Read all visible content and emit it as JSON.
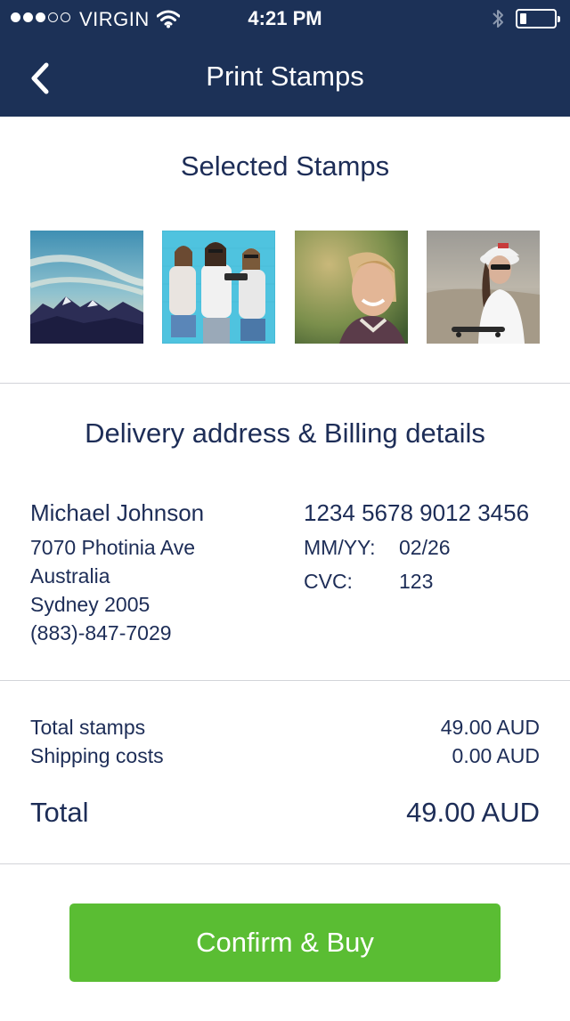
{
  "status_bar": {
    "carrier": "VIRGIN",
    "time": "4:21 PM",
    "signal_bars_filled": 3,
    "signal_bars_total": 5,
    "battery_level": 0.2
  },
  "nav": {
    "title": "Print Stamps",
    "back_icon": "chevron-left-icon"
  },
  "stamps_section": {
    "title": "Selected Stamps",
    "stamps": [
      {
        "name": "mountain-sky-photo"
      },
      {
        "name": "friends-selfie-photo"
      },
      {
        "name": "smiling-woman-photo"
      },
      {
        "name": "woman-with-cap-photo"
      }
    ]
  },
  "billing_section": {
    "title": "Delivery address & Billing details",
    "address": {
      "name": "Michael Johnson",
      "street": "7070 Photinia Ave",
      "country": "Australia",
      "city": "Sydney 2005",
      "phone": "(883)-847-7029"
    },
    "card": {
      "number": "1234 5678 9012 3456",
      "expiry_label": "MM/YY:",
      "expiry_value": "02/26",
      "cvc_label": "CVC:",
      "cvc_value": "123"
    }
  },
  "summary": {
    "total_stamps_label": "Total stamps",
    "total_stamps_value": "49.00 AUD",
    "shipping_label": "Shipping costs",
    "shipping_value": "0.00 AUD",
    "total_label": "Total",
    "total_value": "49.00 AUD"
  },
  "confirm_button": {
    "label": "Confirm & Buy"
  },
  "colors": {
    "header_bg": "#1c3157",
    "text": "#1d2d57",
    "button_green": "#5abd33",
    "divider": "#d2d4d9"
  }
}
